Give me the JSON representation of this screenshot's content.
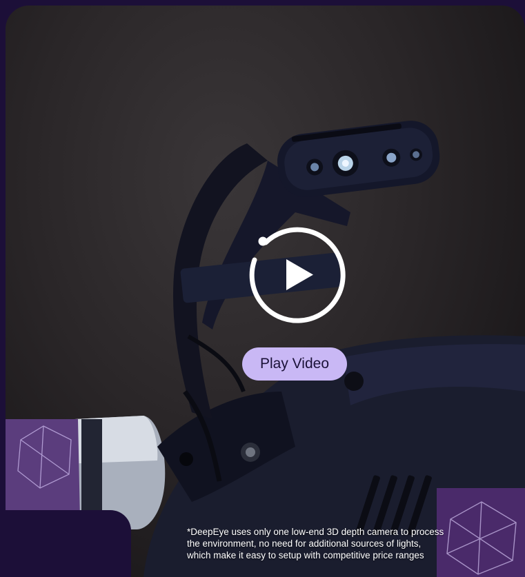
{
  "video": {
    "play_label": "Play Video",
    "caption_lines": [
      "*DeepEye uses only one low-end 3D depth camera to process",
      "the environment, no need for additional sources of lights,",
      "which make it easy to setup with competitive price ranges"
    ]
  },
  "colors": {
    "page_background": "#1c0f38",
    "play_button_background": "#c9b8f5",
    "play_button_text": "#1b1238",
    "caption_text": "#ffffff"
  },
  "icons": {
    "play": "play-circle-icon"
  }
}
